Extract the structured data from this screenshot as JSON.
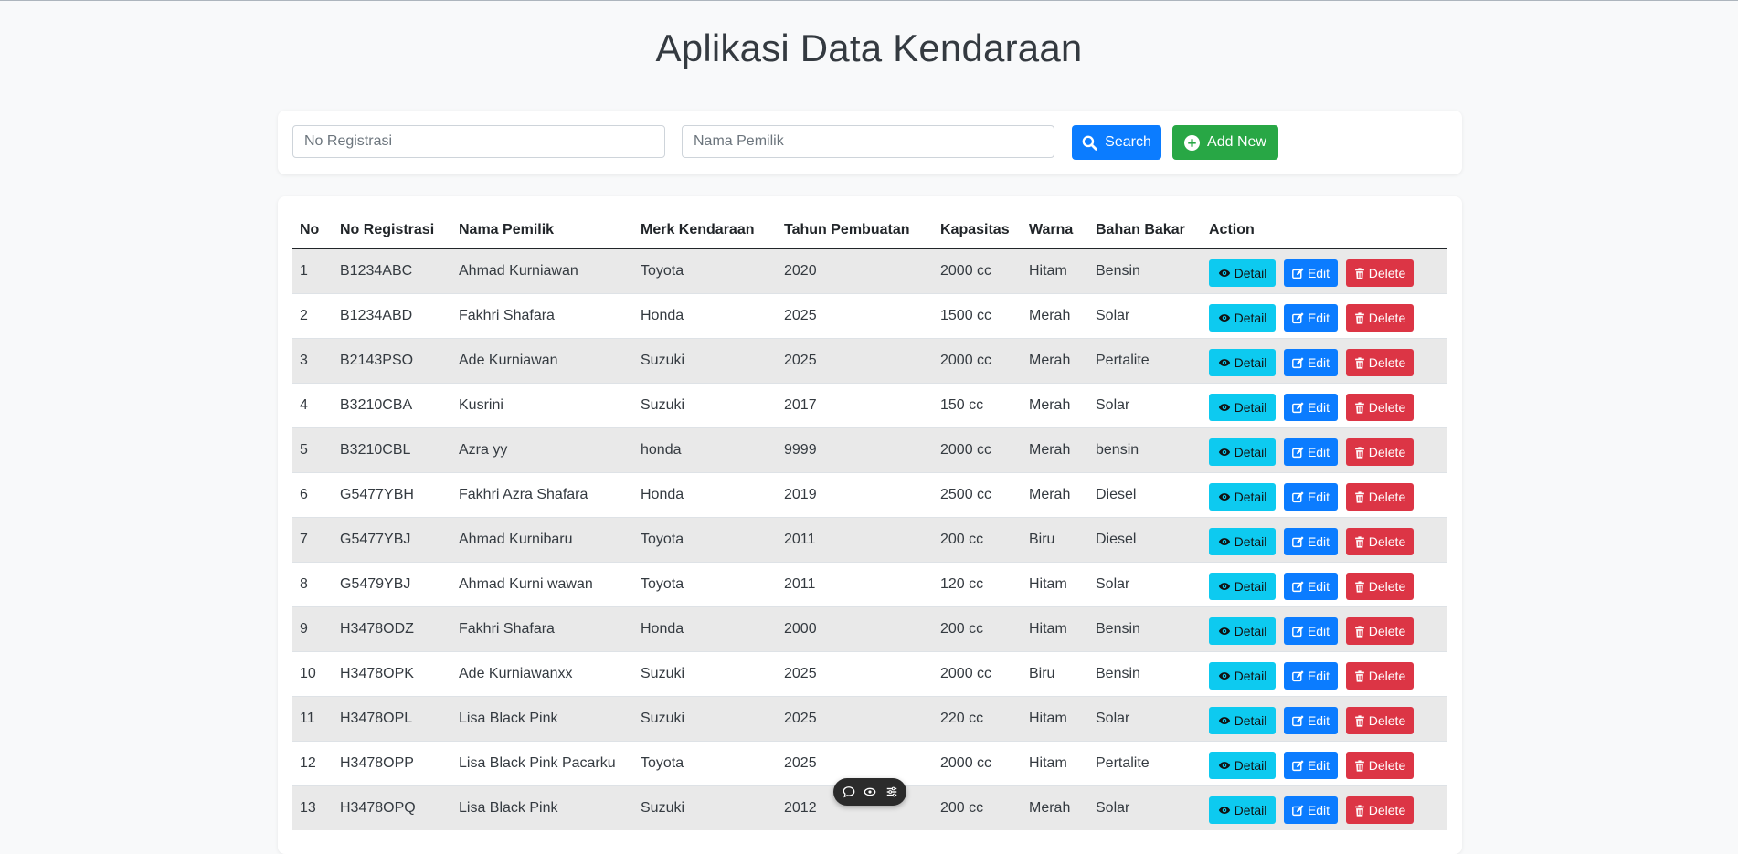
{
  "header": {
    "title": "Aplikasi Data Kendaraan"
  },
  "search": {
    "reg_placeholder": "No Registrasi",
    "owner_placeholder": "Nama Pemilik",
    "search_label": "Search",
    "add_label": "Add New"
  },
  "table": {
    "columns": [
      "No",
      "No Registrasi",
      "Nama Pemilik",
      "Merk Kendaraan",
      "Tahun Pembuatan",
      "Kapasitas",
      "Warna",
      "Bahan Bakar",
      "Action"
    ],
    "actions": {
      "detail": "Detail",
      "edit": "Edit",
      "delete": "Delete"
    },
    "rows": [
      [
        "1",
        "B1234ABC",
        "Ahmad Kurniawan",
        "Toyota",
        "2020",
        "2000 cc",
        "Hitam",
        "Bensin"
      ],
      [
        "2",
        "B1234ABD",
        "Fakhri Shafara",
        "Honda",
        "2025",
        "1500 cc",
        "Merah",
        "Solar"
      ],
      [
        "3",
        "B2143PSO",
        "Ade Kurniawan",
        "Suzuki",
        "2025",
        "2000 cc",
        "Merah",
        "Pertalite"
      ],
      [
        "4",
        "B3210CBA",
        "Kusrini",
        "Suzuki",
        "2017",
        "150 cc",
        "Merah",
        "Solar"
      ],
      [
        "5",
        "B3210CBL",
        "Azra yy",
        "honda",
        "9999",
        "2000 cc",
        "Merah",
        "bensin"
      ],
      [
        "6",
        "G5477YBH",
        "Fakhri Azra Shafara",
        "Honda",
        "2019",
        "2500 cc",
        "Merah",
        "Diesel"
      ],
      [
        "7",
        "G5477YBJ",
        "Ahmad Kurnibaru",
        "Toyota",
        "2011",
        "200 cc",
        "Biru",
        "Diesel"
      ],
      [
        "8",
        "G5479YBJ",
        "Ahmad Kurni wawan",
        "Toyota",
        "2011",
        "120 cc",
        "Hitam",
        "Solar"
      ],
      [
        "9",
        "H3478ODZ",
        "Fakhri Shafara",
        "Honda",
        "2000",
        "200 cc",
        "Hitam",
        "Bensin"
      ],
      [
        "10",
        "H3478OPK",
        "Ade Kurniawanxx",
        "Suzuki",
        "2025",
        "2000 cc",
        "Biru",
        "Bensin"
      ],
      [
        "11",
        "H3478OPL",
        "Lisa Black Pink",
        "Suzuki",
        "2025",
        "220 cc",
        "Hitam",
        "Solar"
      ],
      [
        "12",
        "H3478OPP",
        "Lisa Black Pink Pacarku",
        "Toyota",
        "2025",
        "2000 cc",
        "Hitam",
        "Pertalite"
      ],
      [
        "13",
        "H3478OPQ",
        "Lisa Black Pink",
        "Suzuki",
        "2012",
        "200 cc",
        "Merah",
        "Solar"
      ]
    ]
  },
  "colors": {
    "primary": "#0b7cff",
    "success": "#28a745",
    "info": "#0dcaf0",
    "danger": "#dc3545"
  },
  "icons": [
    "search-icon",
    "plus-circle-icon",
    "eye-icon",
    "edit-icon",
    "trash-icon",
    "comment-icon",
    "eye-slash-icon",
    "menu-icon"
  ]
}
